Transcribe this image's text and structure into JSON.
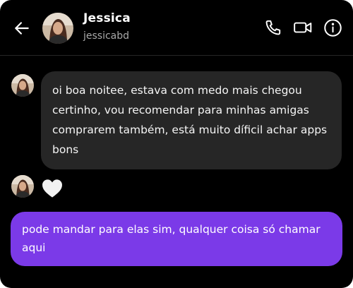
{
  "header": {
    "contact_name": "Jessica",
    "contact_handle": "jessicabd",
    "icons": {
      "back": "arrow-left-icon",
      "call": "phone-icon",
      "video": "video-camera-icon",
      "info": "info-icon"
    }
  },
  "messages": [
    {
      "direction": "incoming",
      "text": "oi boa noitee, estava com medo mais chegou certinho, vou recomendar para minhas amigas comprarem também, está muito díficil achar apps bons"
    },
    {
      "direction": "incoming",
      "type": "reaction",
      "icon": "heart-icon"
    },
    {
      "direction": "outgoing",
      "text": "pode mandar para elas sim, qualquer coisa só chamar aqui"
    }
  ],
  "colors": {
    "background": "#000000",
    "incoming_bubble": "#262626",
    "outgoing_bubble": "#7b3ae8",
    "text_primary": "#ffffff",
    "text_secondary": "#a8a8a8"
  }
}
